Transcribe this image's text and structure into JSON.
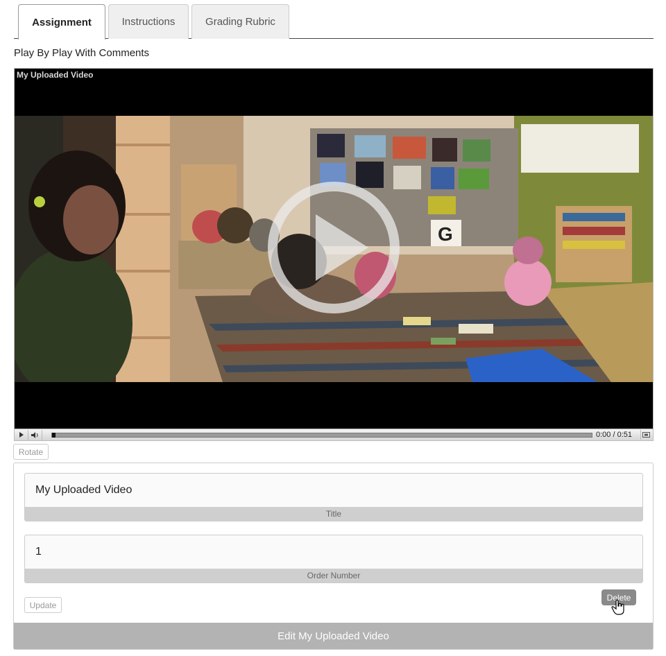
{
  "tabs": [
    {
      "label": "Assignment",
      "active": true
    },
    {
      "label": "Instructions",
      "active": false
    },
    {
      "label": "Grading Rubric",
      "active": false
    }
  ],
  "section_title": "Play By Play With Comments",
  "video": {
    "title": "My Uploaded Video",
    "current_time": "0:00",
    "time_separator": "/",
    "duration": "0:51",
    "progress": 0
  },
  "rotate_label": "Rotate",
  "form": {
    "title_value": "My Uploaded Video",
    "title_label": "Title",
    "order_value": "1",
    "order_label": "Order Number",
    "update_label": "Update",
    "delete_label": "Delete",
    "edit_label": "Edit My Uploaded Video"
  },
  "colors": {
    "accent_gray": "#b3b3b3",
    "delete_bg": "#8a8a8a",
    "video_bg": "#000000"
  }
}
